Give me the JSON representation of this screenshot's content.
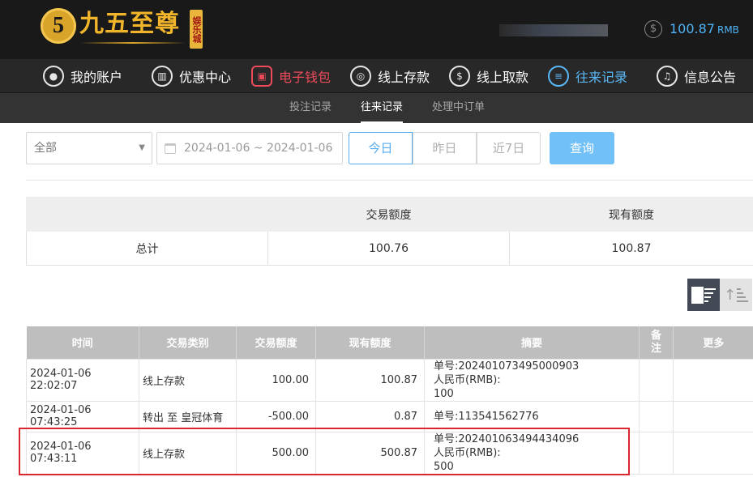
{
  "brand": {
    "emblem": "5",
    "name": "九五至尊",
    "badge": "娱乐城",
    "brand_color": "#f0b52a"
  },
  "account": {
    "balance": "100.87",
    "currency": "RMB"
  },
  "nav": [
    {
      "label": "我的账户",
      "icon": "user-icon"
    },
    {
      "label": "优惠中心",
      "icon": "gift-icon"
    },
    {
      "label": "电子钱包",
      "icon": "wallet-icon",
      "state": "highlight-red"
    },
    {
      "label": "线上存款",
      "icon": "deposit-icon"
    },
    {
      "label": "线上取款",
      "icon": "withdraw-icon"
    },
    {
      "label": "往来记录",
      "icon": "records-icon",
      "state": "active"
    },
    {
      "label": "信息公告",
      "icon": "bell-icon"
    }
  ],
  "subnav": [
    {
      "label": "投注记录"
    },
    {
      "label": "往来记录",
      "state": "active"
    },
    {
      "label": "处理中订单"
    }
  ],
  "filters": {
    "type_select": "全部",
    "date_range": "2024-01-06 ~ 2024-01-06",
    "quick": [
      "今日",
      "昨日",
      "近7日"
    ],
    "quick_active": "今日",
    "query_button": "查询"
  },
  "summary": {
    "headers": [
      "交易额度",
      "现有额度"
    ],
    "row_label": "总计",
    "transaction_amount": "100.76",
    "current_balance": "100.87"
  },
  "sort": {
    "desc_icon": "sort-desc-icon",
    "asc_icon": "sort-asc-icon",
    "active": "desc"
  },
  "records": {
    "headers": [
      "时间",
      "交易类别",
      "交易额度",
      "现有额度",
      "摘要",
      "备注",
      "更多"
    ],
    "rows": [
      {
        "time": "2024-01-06 22:02:07",
        "type": "线上存款",
        "amount": "100.00",
        "balance": "100.87",
        "memo": [
          "单号:202401073495000903",
          "人民币(RMB):",
          "100"
        ],
        "remark": "",
        "more": ""
      },
      {
        "time": "2024-01-06 07:43:25",
        "type": "转出 至 皇冠体育",
        "amount": "-500.00",
        "balance": "0.87",
        "memo": [
          "单号:113541562776"
        ],
        "remark": "",
        "more": ""
      },
      {
        "time": "2024-01-06 07:43:11",
        "type": "线上存款",
        "amount": "500.00",
        "balance": "500.87",
        "memo": [
          "单号:202401063494434096",
          "人民币(RMB):",
          "500"
        ],
        "remark": "",
        "more": ""
      }
    ]
  },
  "colors": {
    "accent": "#57acf0",
    "danger": "#d9262f",
    "header_bg": "#191919"
  }
}
